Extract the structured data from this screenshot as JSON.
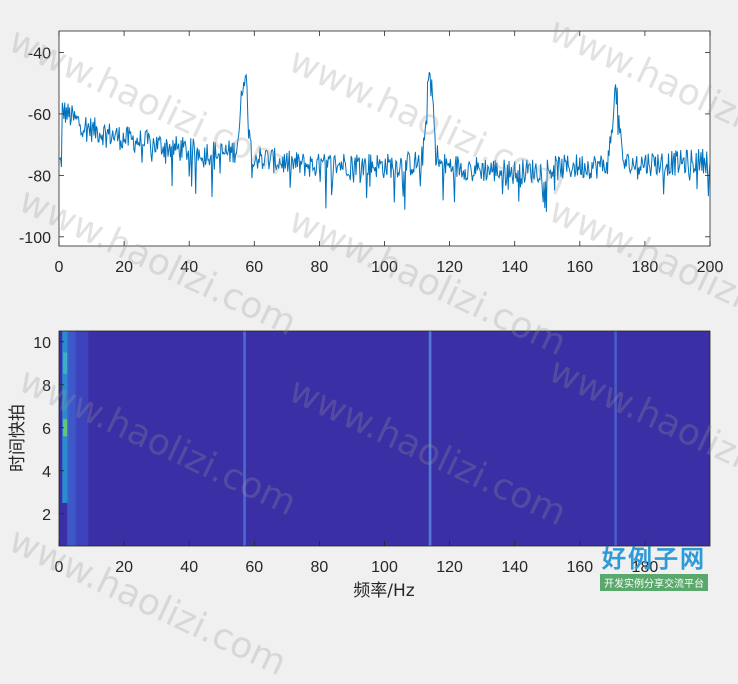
{
  "chart_data": [
    {
      "type": "line",
      "xlim": [
        0,
        200
      ],
      "ylim": [
        -103,
        -33
      ],
      "xticks": [
        "0",
        "20",
        "40",
        "60",
        "80",
        "100",
        "120",
        "140",
        "160",
        "180",
        "200"
      ],
      "yticks": [
        "-40",
        "-60",
        "-80",
        "-100"
      ],
      "line_color": "#0072bd",
      "sample_spacing": 0.25,
      "baseline": [
        [
          0,
          -58
        ],
        [
          5,
          -62
        ],
        [
          10,
          -65
        ],
        [
          20,
          -68
        ],
        [
          30,
          -70
        ],
        [
          40,
          -72
        ],
        [
          50,
          -73
        ],
        [
          55,
          -72
        ],
        [
          60,
          -74
        ],
        [
          70,
          -76
        ],
        [
          80,
          -77
        ],
        [
          90,
          -76
        ],
        [
          100,
          -77
        ],
        [
          110,
          -76
        ],
        [
          120,
          -77
        ],
        [
          130,
          -78
        ],
        [
          140,
          -79
        ],
        [
          150,
          -78
        ],
        [
          160,
          -77
        ],
        [
          170,
          -77
        ],
        [
          180,
          -76
        ],
        [
          190,
          -76
        ],
        [
          200,
          -75
        ]
      ],
      "peaks": [
        {
          "x": 57,
          "y": -47
        },
        {
          "x": 114,
          "y": -47
        },
        {
          "x": 171,
          "y": -53
        }
      ],
      "noise_amplitude": 6
    },
    {
      "type": "heatmap",
      "xlim": [
        0,
        200
      ],
      "ylim": [
        0.5,
        10.5
      ],
      "xticks": [
        "0",
        "20",
        "40",
        "60",
        "80",
        "100",
        "120",
        "140",
        "160",
        "180"
      ],
      "yticks": [
        "2",
        "4",
        "6",
        "8",
        "10"
      ],
      "xlabel": "频率/Hz",
      "ylabel": "时间快拍",
      "background": "#3b2fa5",
      "stripes": [
        {
          "x": 2,
          "width": 2,
          "color": "#2a9bd2",
          "from": 2.5,
          "to": 10.5
        },
        {
          "x": 2,
          "width": 1.5,
          "color": "#6cd06a",
          "from": 5.6,
          "to": 6.4
        },
        {
          "x": 2,
          "width": 1.5,
          "color": "#3fb7c4",
          "from": 8.5,
          "to": 9.5
        },
        {
          "x": 4,
          "width": 3,
          "color": "#3f5fd0",
          "from": 0.5,
          "to": 10.5
        },
        {
          "x": 7,
          "width": 4,
          "color": "#3d46bf",
          "from": 0.5,
          "to": 10.5
        },
        {
          "x": 57,
          "width": 0.8,
          "color": "#4f74d8",
          "from": 0.5,
          "to": 10.5
        },
        {
          "x": 114,
          "width": 0.8,
          "color": "#5a86de",
          "from": 0.5,
          "to": 10.5
        },
        {
          "x": 171,
          "width": 0.8,
          "color": "#4b64cc",
          "from": 0.5,
          "to": 10.5
        }
      ]
    }
  ],
  "watermark": {
    "text": "www.haolizi.com"
  },
  "logo": {
    "main": "好例子网",
    "sub": "开发实例分享交流平台"
  }
}
